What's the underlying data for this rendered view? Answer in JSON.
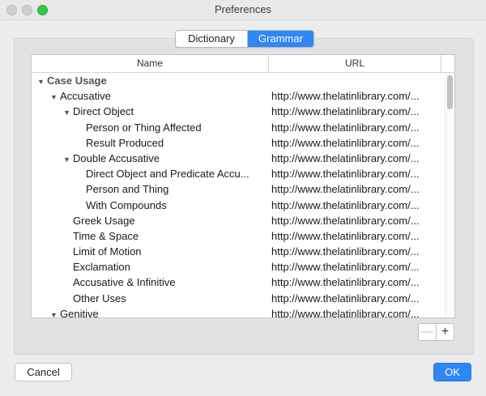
{
  "window": {
    "title": "Preferences"
  },
  "tabs": [
    {
      "label": "Dictionary",
      "selected": false
    },
    {
      "label": "Grammar",
      "selected": true
    }
  ],
  "table": {
    "columns": [
      "Name",
      "URL"
    ],
    "rows": [
      {
        "name": "Case Usage",
        "url": "",
        "depth": 0,
        "expanded": true,
        "group": true
      },
      {
        "name": "Accusative",
        "url": "http://www.thelatinlibrary.com/...",
        "depth": 1,
        "expanded": true
      },
      {
        "name": "Direct Object",
        "url": "http://www.thelatinlibrary.com/...",
        "depth": 2,
        "expanded": true
      },
      {
        "name": "Person or Thing Affected",
        "url": "http://www.thelatinlibrary.com/...",
        "depth": 3
      },
      {
        "name": "Result Produced",
        "url": "http://www.thelatinlibrary.com/...",
        "depth": 3
      },
      {
        "name": "Double Accusative",
        "url": "http://www.thelatinlibrary.com/...",
        "depth": 2,
        "expanded": true
      },
      {
        "name": "Direct Object and Predicate Accu...",
        "url": "http://www.thelatinlibrary.com/...",
        "depth": 3
      },
      {
        "name": "Person and Thing",
        "url": "http://www.thelatinlibrary.com/...",
        "depth": 3
      },
      {
        "name": "With Compounds",
        "url": "http://www.thelatinlibrary.com/...",
        "depth": 3
      },
      {
        "name": "Greek Usage",
        "url": "http://www.thelatinlibrary.com/...",
        "depth": 2
      },
      {
        "name": "Time & Space",
        "url": "http://www.thelatinlibrary.com/...",
        "depth": 2
      },
      {
        "name": "Limit of Motion",
        "url": "http://www.thelatinlibrary.com/...",
        "depth": 2
      },
      {
        "name": "Exclamation",
        "url": "http://www.thelatinlibrary.com/...",
        "depth": 2
      },
      {
        "name": "Accusative & Infinitive",
        "url": "http://www.thelatinlibrary.com/...",
        "depth": 2
      },
      {
        "name": "Other Uses",
        "url": "http://www.thelatinlibrary.com/...",
        "depth": 2
      },
      {
        "name": "Genitive",
        "url": "http://www.thelatinlibrary.com/...",
        "depth": 1,
        "expanded": true
      }
    ]
  },
  "controls": {
    "remove_label": "—",
    "add_label": "+"
  },
  "buttons": {
    "cancel": "Cancel",
    "ok": "OK"
  },
  "colors": {
    "accent": "#2f86f6",
    "zoom": "#2fca3f"
  }
}
